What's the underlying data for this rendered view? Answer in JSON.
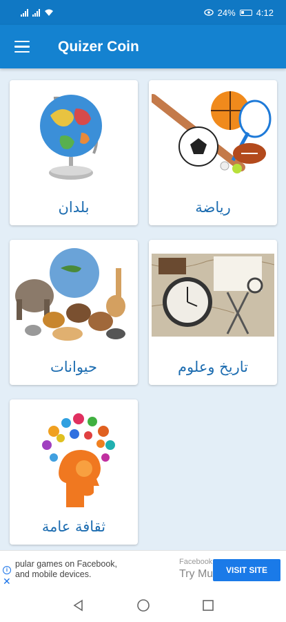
{
  "status_bar": {
    "battery": "24%",
    "time": "4:12"
  },
  "app_bar": {
    "title": "Quizer Coin",
    "menu_icon": "hamburger-menu-icon"
  },
  "categories": [
    {
      "label": "بلدان",
      "icon": "globe-image"
    },
    {
      "label": "رياضة",
      "icon": "sports-equipment-image"
    },
    {
      "label": "حيوانات",
      "icon": "animals-image"
    },
    {
      "label": "تاريخ وعلوم",
      "icon": "clock-and-compass-image"
    },
    {
      "label": "ثقافة عامة",
      "icon": "brain-head-image"
    }
  ],
  "ad": {
    "text_line1": "pular games on Facebook,",
    "text_line2": "and mobile devices.",
    "brand": "Facebook",
    "headline": "Try Mu",
    "button_label": "VISIT SITE",
    "button_color": "#1a7ae8"
  },
  "colors": {
    "app_bar": "#1482d0",
    "status_bar": "#1078c4",
    "label": "#1c6cb0",
    "background": "#e3eef7"
  }
}
